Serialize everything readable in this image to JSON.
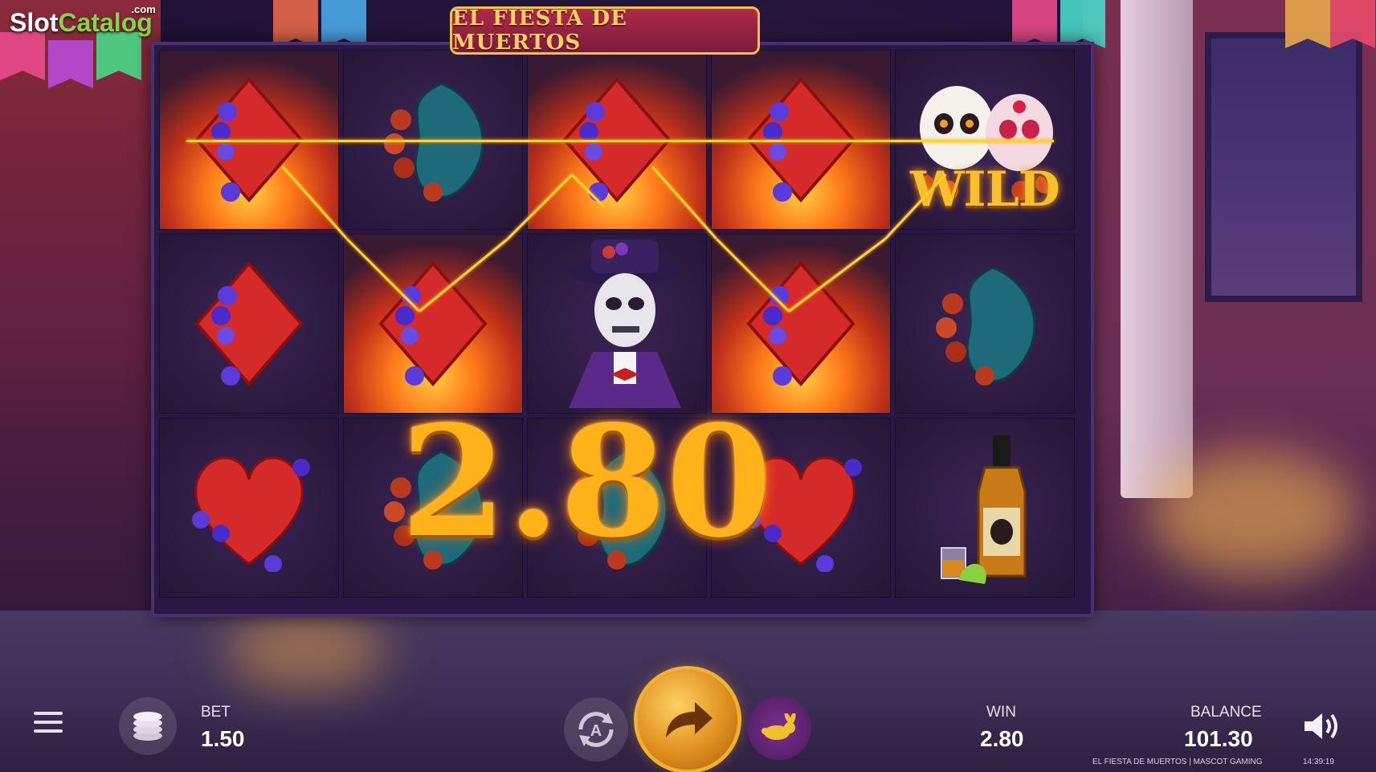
{
  "branding": {
    "watermark_main": "Slot",
    "watermark_accent": "Catalog",
    "watermark_suffix": ".com",
    "game_title": "EL FIESTA DE MUERTOS"
  },
  "reels": {
    "columns": 5,
    "rows": 3,
    "grid": [
      [
        "diamond",
        "spade",
        "diamond",
        "diamond",
        "wild"
      ],
      [
        "diamond",
        "diamond",
        "skeleton-man",
        "diamond",
        "spade"
      ],
      [
        "heart",
        "spade",
        "spade",
        "heart",
        "tequila"
      ]
    ],
    "winning_cells": [
      [
        0,
        0
      ],
      [
        0,
        2
      ],
      [
        0,
        3
      ],
      [
        1,
        1
      ],
      [
        1,
        3
      ]
    ],
    "wild_label": "WILD"
  },
  "win_overlay": {
    "amount": "2.80"
  },
  "controls": {
    "bet_label": "BET",
    "bet_value": "1.50",
    "win_label": "WIN",
    "win_value": "2.80",
    "balance_label": "BALANCE",
    "balance_value": "101.30",
    "autoplay_letter": "A"
  },
  "footer": {
    "game_info": "EL FIESTA DE MUERTOS | MASCOT GAMING",
    "clock": "14:39:19"
  },
  "icons": {
    "menu": "menu-icon",
    "coins": "coins-icon",
    "autoplay": "autoplay-icon",
    "spin": "spin-arrow-icon",
    "turbo": "rabbit-icon",
    "sound": "speaker-icon"
  },
  "colors": {
    "gold": "#ffb21a",
    "reel_bg": "#2a1844",
    "win_glow": "#ff7a1a",
    "spin_button": "#e09020",
    "turbo_button": "#6a2a80"
  }
}
